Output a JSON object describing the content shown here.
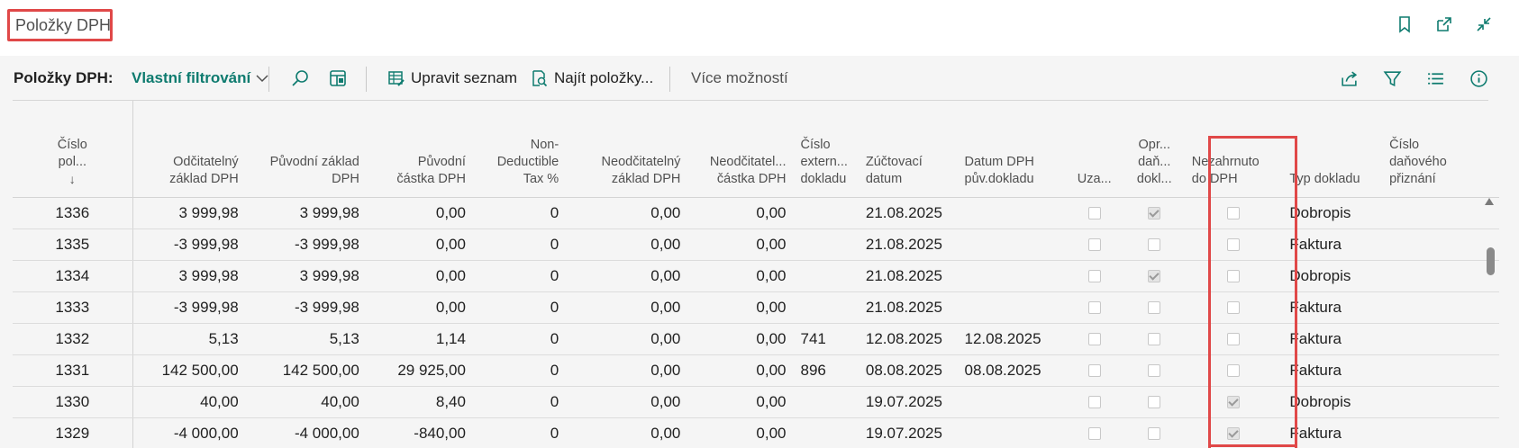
{
  "page": {
    "title": "Položky DPH"
  },
  "actionbar": {
    "label": "Položky DPH:",
    "filter": "Vlastní filtrování",
    "edit_list": "Upravit seznam",
    "find_entries": "Najít položky...",
    "more_options": "Více možností"
  },
  "columns": [
    "Číslo pol... ↓",
    "Odčitatelný základ DPH",
    "Původní základ DPH",
    "Původní částka DPH",
    "Non-Deductible Tax %",
    "Neodčitatelný základ DPH",
    "Neodčitatel... částka DPH",
    "Číslo extern... dokladu",
    "Zúčtovací datum",
    "Datum DPH pův.dokladu",
    "Uza...",
    "Opr... daň... dokl...",
    "Nezahrnuto do DPH",
    "Typ dokladu",
    "Číslo daňového přiznání"
  ],
  "headers": {
    "c0a": "Číslo",
    "c0b": "pol...",
    "c0c": "↓",
    "c1a": "Odčitatelný",
    "c1b": "základ DPH",
    "c2a": "Původní základ",
    "c2b": "DPH",
    "c3a": "Původní",
    "c3b": "částka DPH",
    "c4a": "Non-",
    "c4b": "Deductible",
    "c4c": "Tax %",
    "c5a": "Neodčitatelný",
    "c5b": "základ DPH",
    "c6a": "Neodčitatel...",
    "c6b": "částka DPH",
    "c7a": "Číslo",
    "c7b": "extern...",
    "c7c": "dokladu",
    "c8a": "Zúčtovací",
    "c8b": "datum",
    "c9a": "Datum DPH",
    "c9b": "pův.dokladu",
    "c10a": "Uza...",
    "c11a": "Opr...",
    "c11b": "daň...",
    "c11c": "dokl...",
    "c12a": "Nezahrnuto",
    "c12b": "do DPH",
    "c13a": "Typ dokladu",
    "c14a": "Číslo",
    "c14b": "daňového",
    "c14c": "přiznání"
  },
  "rows": [
    {
      "no": "1336",
      "ded_base": "3 999,98",
      "orig_base": "3 999,98",
      "orig_amt": "0,00",
      "nd_pct": "0",
      "nd_base": "0,00",
      "nd_amt": "0,00",
      "ext": "",
      "post": "21.08.2025",
      "orig_date": "",
      "closed": false,
      "corr": true,
      "excl": false,
      "type": "Dobropis"
    },
    {
      "no": "1335",
      "ded_base": "-3 999,98",
      "orig_base": "-3 999,98",
      "orig_amt": "0,00",
      "nd_pct": "0",
      "nd_base": "0,00",
      "nd_amt": "0,00",
      "ext": "",
      "post": "21.08.2025",
      "orig_date": "",
      "closed": false,
      "corr": false,
      "excl": false,
      "type": "Faktura"
    },
    {
      "no": "1334",
      "ded_base": "3 999,98",
      "orig_base": "3 999,98",
      "orig_amt": "0,00",
      "nd_pct": "0",
      "nd_base": "0,00",
      "nd_amt": "0,00",
      "ext": "",
      "post": "21.08.2025",
      "orig_date": "",
      "closed": false,
      "corr": true,
      "excl": false,
      "type": "Dobropis"
    },
    {
      "no": "1333",
      "ded_base": "-3 999,98",
      "orig_base": "-3 999,98",
      "orig_amt": "0,00",
      "nd_pct": "0",
      "nd_base": "0,00",
      "nd_amt": "0,00",
      "ext": "",
      "post": "21.08.2025",
      "orig_date": "",
      "closed": false,
      "corr": false,
      "excl": false,
      "type": "Faktura"
    },
    {
      "no": "1332",
      "ded_base": "5,13",
      "orig_base": "5,13",
      "orig_amt": "1,14",
      "nd_pct": "0",
      "nd_base": "0,00",
      "nd_amt": "0,00",
      "ext": "741",
      "post": "12.08.2025",
      "orig_date": "12.08.2025",
      "closed": false,
      "corr": false,
      "excl": false,
      "type": "Faktura"
    },
    {
      "no": "1331",
      "ded_base": "142 500,00",
      "orig_base": "142 500,00",
      "orig_amt": "29 925,00",
      "nd_pct": "0",
      "nd_base": "0,00",
      "nd_amt": "0,00",
      "ext": "896",
      "post": "08.08.2025",
      "orig_date": "08.08.2025",
      "closed": false,
      "corr": false,
      "excl": false,
      "type": "Faktura"
    },
    {
      "no": "1330",
      "ded_base": "40,00",
      "orig_base": "40,00",
      "orig_amt": "8,40",
      "nd_pct": "0",
      "nd_base": "0,00",
      "nd_amt": "0,00",
      "ext": "",
      "post": "19.07.2025",
      "orig_date": "",
      "closed": false,
      "corr": false,
      "excl": true,
      "type": "Dobropis"
    },
    {
      "no": "1329",
      "ded_base": "-4 000,00",
      "orig_base": "-4 000,00",
      "orig_amt": "-840,00",
      "nd_pct": "0",
      "nd_base": "0,00",
      "nd_amt": "0,00",
      "ext": "",
      "post": "19.07.2025",
      "orig_date": "",
      "closed": false,
      "corr": false,
      "excl": true,
      "type": "Faktura"
    }
  ],
  "icons": {
    "bookmark": "bookmark-icon",
    "open_new": "open-new-window-icon",
    "collapse": "collapse-icon",
    "search": "search-icon",
    "layout": "layout-icon",
    "edit_list": "edit-list-icon",
    "find": "find-entries-icon",
    "share": "share-icon",
    "filter": "filter-icon",
    "list": "list-view-icon",
    "info": "info-icon"
  },
  "colors": {
    "accent": "#0e7b6f",
    "highlight": "#e04848"
  }
}
